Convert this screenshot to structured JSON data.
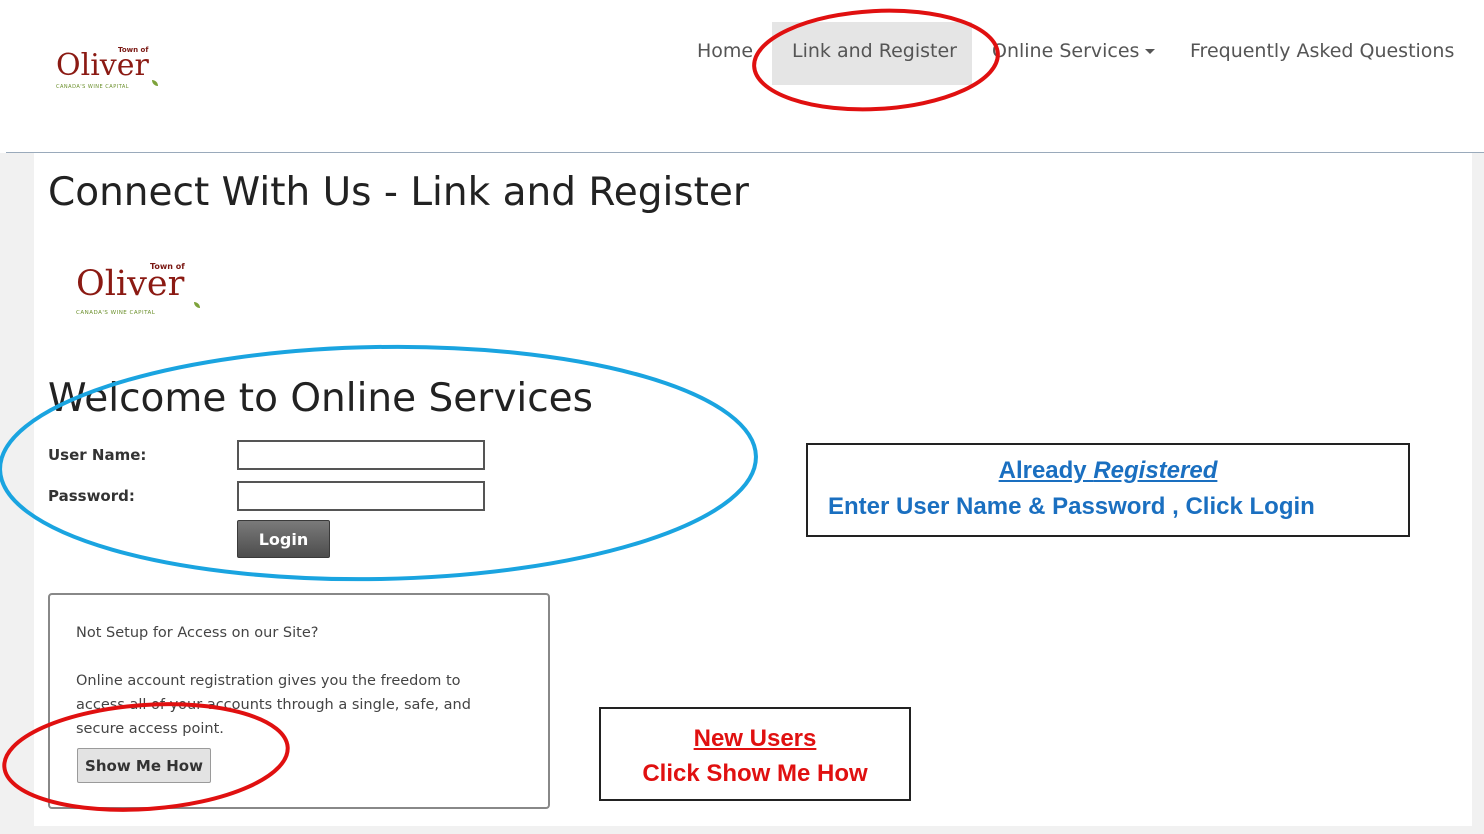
{
  "header": {
    "logo": {
      "town_of": "Town of",
      "name": "Oliver",
      "tagline": "CANADA'S WINE CAPITAL"
    },
    "nav": [
      {
        "label": "Home"
      },
      {
        "label": "Link and Register",
        "active": true
      },
      {
        "label": "Online Services",
        "dropdown": true
      },
      {
        "label": "Frequently Asked Questions"
      }
    ]
  },
  "main": {
    "page_title": "Connect With Us - Link and Register",
    "logo": {
      "town_of": "Town of",
      "name": "Oliver",
      "tagline": "CANADA'S WINE CAPITAL"
    },
    "welcome_heading": "Welcome to Online Services",
    "login": {
      "username_label": "User Name:",
      "password_label": "Password:",
      "username_value": "",
      "password_value": "",
      "login_button": "Login"
    },
    "registration": {
      "question": "Not Setup for Access on our Site?",
      "description_line1": "Online account registration gives you the freedom to",
      "description_line2": "access all of your accounts through a single, safe, and",
      "description_line3": "secure access point.",
      "button": "Show Me How"
    }
  },
  "annotations": {
    "registered_callout": {
      "line1_prefix": "Already ",
      "line1_emphasis": "Registered",
      "line2": "Enter User Name & Password , Click Login",
      "color": "#1a6fc0"
    },
    "new_users_callout": {
      "line1": "New Users",
      "line2": "Click Show Me How",
      "color": "#e01010"
    },
    "circle_colors": {
      "red": "#e01010",
      "blue": "#1aa4e0"
    }
  },
  "colors": {
    "brand": "#8b1a13",
    "tagline": "#6a8f2a",
    "nav_active_bg": "#e5e5e5"
  }
}
